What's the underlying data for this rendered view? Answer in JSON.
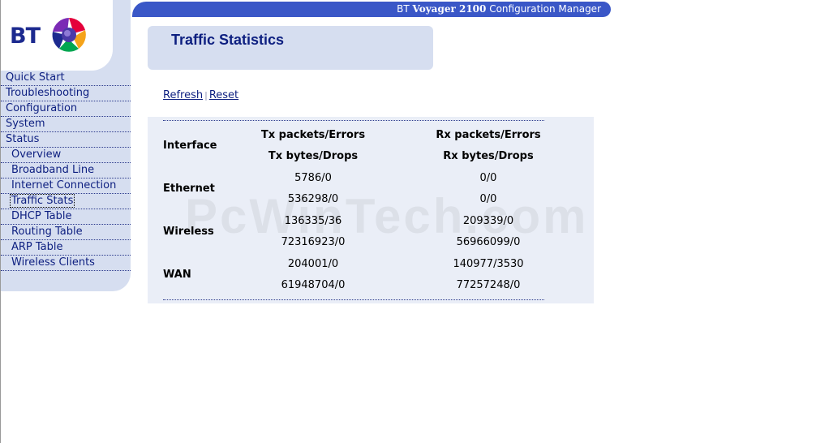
{
  "header": {
    "brand": "BT",
    "product": "Voyager 2100",
    "subtitle": "Configuration Manager"
  },
  "logo": {
    "text": "BT",
    "colors": {
      "blue": "#1c2a8f",
      "purple": "#7b2bb5",
      "red": "#e4003b",
      "green": "#00a651",
      "orange": "#f5a31a"
    }
  },
  "nav": {
    "items": [
      {
        "label": "Quick Start",
        "sub": false
      },
      {
        "label": "Troubleshooting",
        "sub": false
      },
      {
        "label": "Configuration",
        "sub": false
      },
      {
        "label": "System",
        "sub": false
      },
      {
        "label": "Status",
        "sub": false
      },
      {
        "label": "Overview",
        "sub": true
      },
      {
        "label": "Broadband Line",
        "sub": true
      },
      {
        "label": "Internet Connection",
        "sub": true
      },
      {
        "label": "Traffic Stats",
        "sub": true,
        "active": true
      },
      {
        "label": "DHCP Table",
        "sub": true
      },
      {
        "label": "Routing Table",
        "sub": true
      },
      {
        "label": "ARP Table",
        "sub": true
      },
      {
        "label": "Wireless Clients",
        "sub": true
      }
    ]
  },
  "page": {
    "title": "Traffic Statistics"
  },
  "actions": {
    "refresh": "Refresh",
    "separator": "|",
    "reset": "Reset"
  },
  "table": {
    "header_label": "Interface",
    "tx_header_1": "Tx packets/Errors",
    "tx_header_2": "Tx bytes/Drops",
    "rx_header_1": "Rx packets/Errors",
    "rx_header_2": "Rx bytes/Drops",
    "rows": [
      {
        "name": "Ethernet",
        "tx_packets_errors": "5786/0",
        "tx_bytes_drops": "536298/0",
        "rx_packets_errors": "0/0",
        "rx_bytes_drops": "0/0"
      },
      {
        "name": "Wireless",
        "tx_packets_errors": "136335/36",
        "tx_bytes_drops": "72316923/0",
        "rx_packets_errors": "209339/0",
        "rx_bytes_drops": "56966099/0"
      },
      {
        "name": "WAN",
        "tx_packets_errors": "204001/0",
        "tx_bytes_drops": "61948704/0",
        "rx_packets_errors": "140977/3530",
        "rx_bytes_drops": "77257248/0"
      }
    ]
  },
  "watermark": "PcWinTech.com",
  "colors": {
    "nav_text": "#0d1f80",
    "panel_bg": "#d6def0",
    "topbar": "#3a57c7",
    "table_bg": "#eaeef7"
  }
}
